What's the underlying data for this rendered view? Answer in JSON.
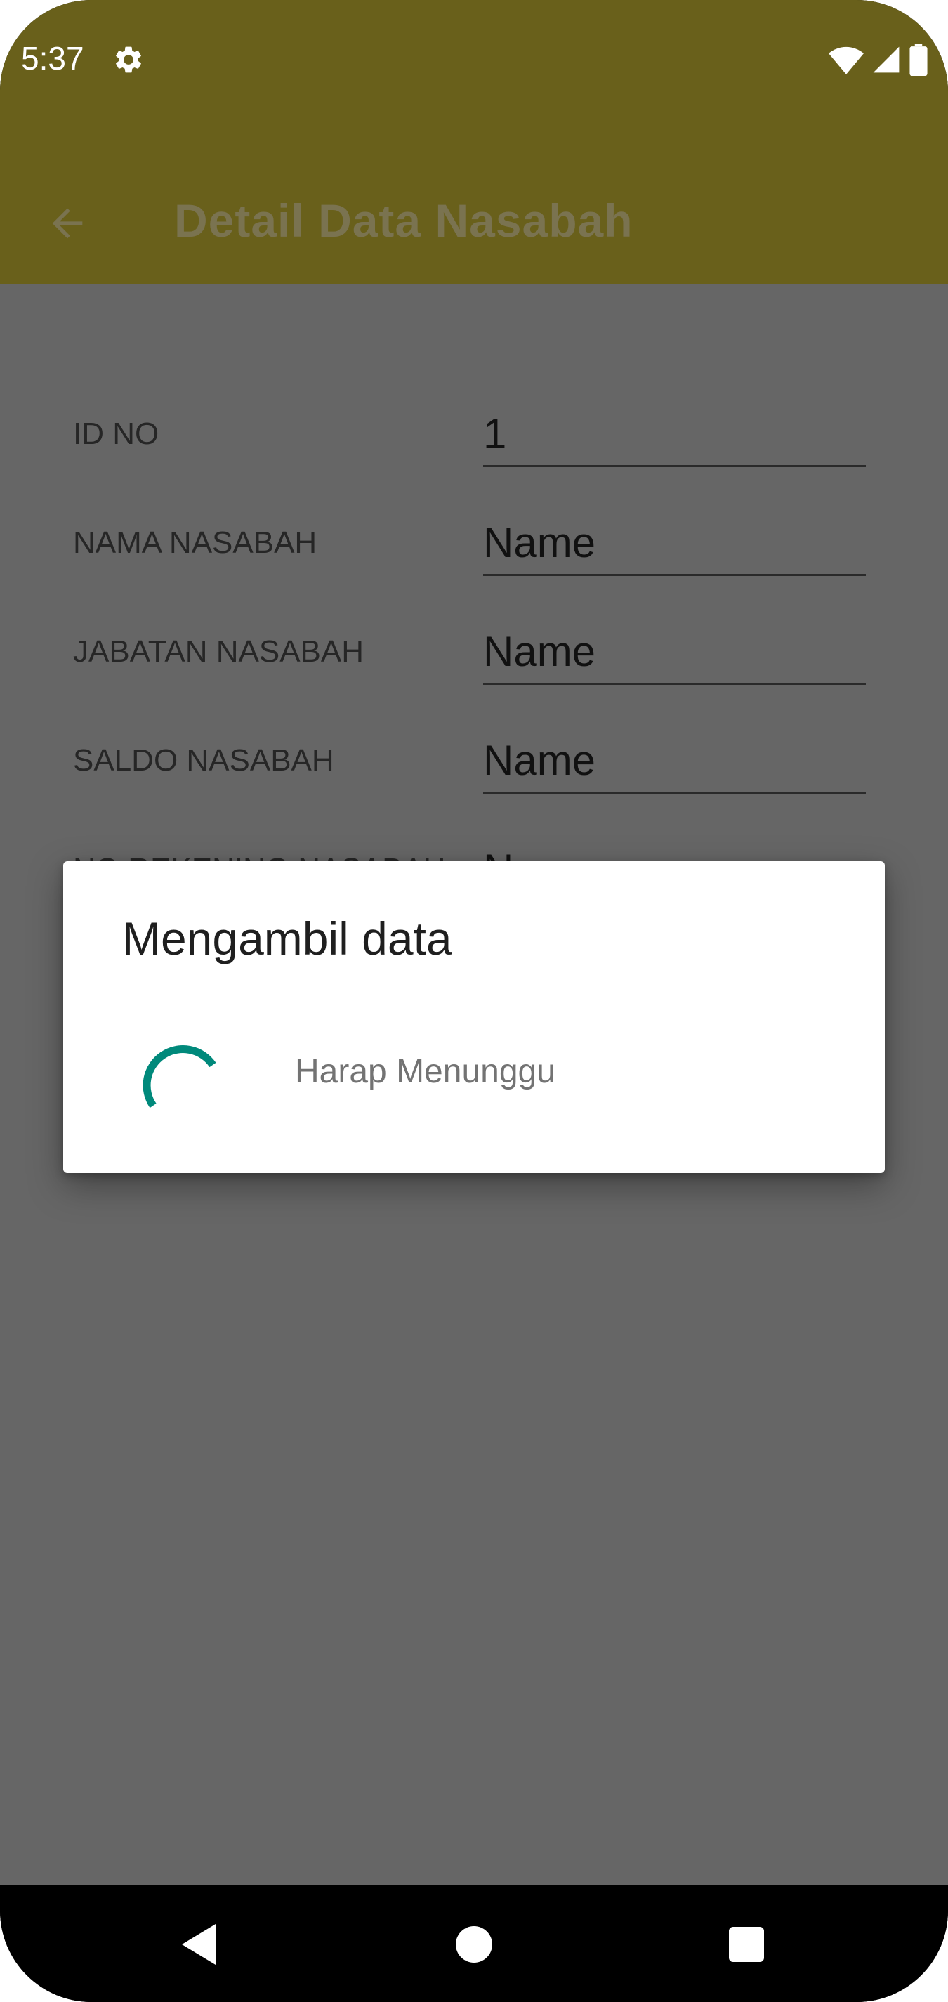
{
  "status_bar": {
    "time": "5:37",
    "icons": [
      "settings-gear-icon",
      "wifi-icon",
      "cellular-signal-icon",
      "battery-icon"
    ]
  },
  "app_bar": {
    "title": "Detail Data Nasabah",
    "back_icon": "arrow-back-icon"
  },
  "form": {
    "rows": [
      {
        "label": "ID NO",
        "value": "1"
      },
      {
        "label": "NAMA NASABAH",
        "value": "Name"
      },
      {
        "label": "JABATAN NASABAH",
        "value": "Name"
      },
      {
        "label": "SALDO NASABAH",
        "value": "Name"
      },
      {
        "label": "NO REKENING NASABAH",
        "value": "Name"
      }
    ]
  },
  "dialog": {
    "title": "Mengambil data",
    "message": "Harap Menunggu",
    "spinner_color": "#00897b"
  },
  "nav_bar": {
    "buttons": [
      "back-triangle-icon",
      "home-circle-icon",
      "recents-square-icon"
    ]
  },
  "colors": {
    "app_bar_dimmed": "#69601b",
    "content_dimmed": "#666666",
    "accent_spinner": "#00897b"
  }
}
